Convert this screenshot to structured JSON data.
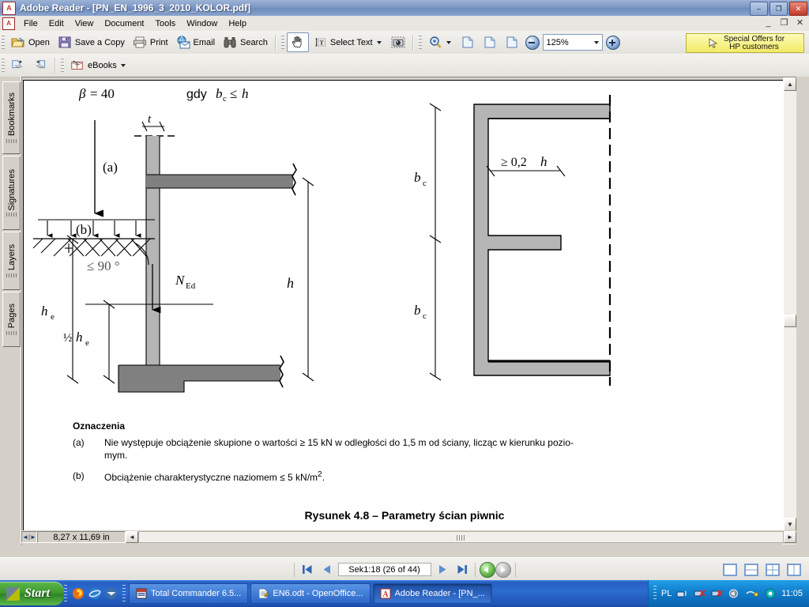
{
  "window": {
    "title": "Adobe Reader - [PN_EN_1996_3_2010_KOLOR.pdf]",
    "app_icon": "adobe-reader-icon",
    "minimize": "–",
    "maximize": "❐",
    "close": "✕"
  },
  "menu": {
    "items": [
      "File",
      "Edit",
      "View",
      "Document",
      "Tools",
      "Window",
      "Help"
    ],
    "mdi_minimize": "_",
    "mdi_restore": "❐",
    "mdi_close": "✕"
  },
  "toolbar1": {
    "open_label": "Open",
    "save_label": "Save a Copy",
    "print_label": "Print",
    "email_label": "Email",
    "search_label": "Search",
    "select_text_label": "Select Text",
    "zoom_value": "125%"
  },
  "toolbar2": {
    "ebooks_label": "eBooks"
  },
  "promo": {
    "line1": "Special Offers for",
    "line2": "HP customers"
  },
  "sidebar": {
    "tabs": [
      {
        "label": "Bookmarks"
      },
      {
        "label": "Signatures"
      },
      {
        "label": "Layers"
      },
      {
        "label": "Pages"
      }
    ]
  },
  "document": {
    "page_size": "8,27 x 11,69 in",
    "figure": {
      "beta_formula": "β = 40",
      "condition": "gdy b",
      "condition_sub": "c",
      "condition_tail": " ≤ h",
      "label_a": "(a)",
      "label_b": "(b)",
      "label_t": "t",
      "label_h": "h",
      "label_he": "h",
      "label_he_sub": "e",
      "label_half_he": "½ h",
      "label_half_he_sub": "e",
      "label_ned": "N",
      "label_ned_sub": "Ed",
      "label_angle": "≤ 90 °",
      "label_bc1": "b",
      "label_bc1_sub": "c",
      "label_bc2": "b",
      "label_bc2_sub": "c",
      "label_thickness": "≥ 0,2 h"
    },
    "legend_heading": "Oznaczenia",
    "notes": [
      {
        "marker": "(a)",
        "text": "Nie występuje obciążenie skupione o wartości ≥ 15 kN w odległości do 1,5 m od ściany, licząc w kierunku pozio-"
      },
      {
        "marker": "",
        "text": "mym."
      },
      {
        "marker": "(b)",
        "text": "Obciążenie charakterystyczne naziomem ≤ 5 kN/m",
        "sup": "2",
        "tail": "."
      }
    ],
    "figure_caption": "Rysunek 4.8 – Parametry ścian piwnic"
  },
  "statusbar": {
    "page_indicator": "Sek1:18  (26 of 44)",
    "first_page_icon": "first-page-icon",
    "prev_page_icon": "previous-page-icon",
    "next_page_icon": "next-page-icon",
    "last_page_icon": "last-page-icon",
    "back_icon": "go-back-icon",
    "forward_icon": "go-forward-icon"
  },
  "taskbar": {
    "start_label": "Start",
    "quick_launch": [
      {
        "name": "firefox-icon",
        "color": "#e8720a"
      },
      {
        "name": "internet-explorer-icon",
        "color": "#2b7fd0"
      },
      {
        "name": "thunderbird-icon",
        "color": "#3a6ea5"
      }
    ],
    "items": [
      {
        "label": "Total Commander 6.5...",
        "icon": "total-commander-icon",
        "active": false
      },
      {
        "label": "EN6.odt - OpenOffice...",
        "icon": "openoffice-writer-icon",
        "active": false
      },
      {
        "label": "Adobe Reader - [PN_...",
        "icon": "adobe-reader-icon",
        "active": true
      }
    ],
    "language": "PL",
    "clock": "11:05"
  },
  "colors": {
    "title_bar": "#7e98c6",
    "toolbar_bg": "#ece9e3",
    "desktop": "#d4d0c8",
    "taskbar_blue": "#265fc4",
    "start_green": "#3f9a30",
    "promo_yellow": "#f2ea66",
    "wall_light": "#b5b5b5",
    "wall_dark": "#808080",
    "page_white": "#ffffff"
  }
}
